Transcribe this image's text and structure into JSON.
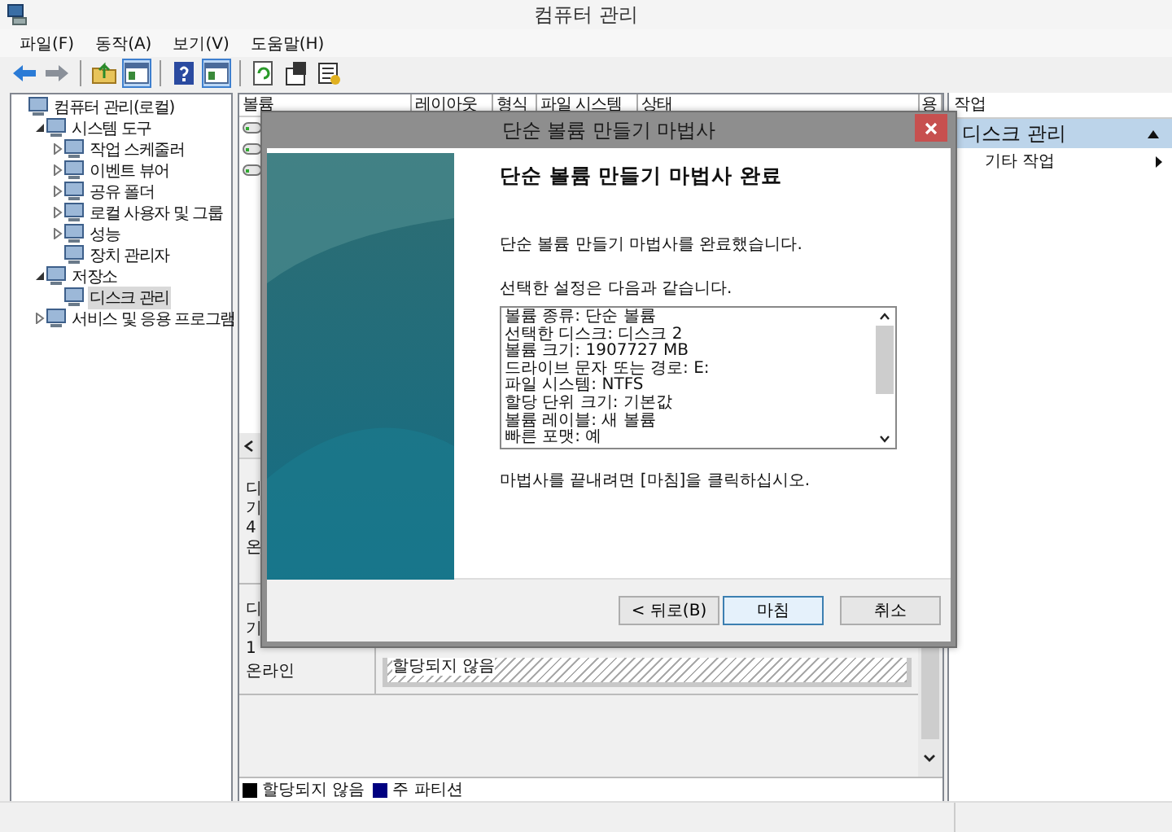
{
  "window": {
    "title": "컴퓨터 관리"
  },
  "menu": [
    "파일(F)",
    "동작(A)",
    "보기(V)",
    "도움말(H)"
  ],
  "toolbar": [
    {
      "kind": "back",
      "pressed": false
    },
    {
      "kind": "forward",
      "pressed": false
    },
    {
      "kind": "sep"
    },
    {
      "kind": "folder",
      "pressed": false
    },
    {
      "kind": "pane",
      "pressed": true
    },
    {
      "kind": "sep"
    },
    {
      "kind": "help",
      "pressed": false
    },
    {
      "kind": "pane",
      "pressed": true
    },
    {
      "kind": "sep"
    },
    {
      "kind": "refresh",
      "pressed": false
    },
    {
      "kind": "properties",
      "pressed": false
    },
    {
      "kind": "export",
      "pressed": false
    }
  ],
  "tree": [
    {
      "label": "컴퓨터 관리(로컬)",
      "selected": false,
      "children": [
        {
          "label": "시스템 도구",
          "expanded": true,
          "selected": false,
          "children": [
            {
              "label": "작업 스케줄러",
              "expanded": false,
              "selected": false
            },
            {
              "label": "이벤트 뷰어",
              "expanded": false,
              "selected": false
            },
            {
              "label": "공유 폴더",
              "expanded": false,
              "selected": false
            },
            {
              "label": "로컬 사용자 및 그룹",
              "expanded": false,
              "selected": false
            },
            {
              "label": "성능",
              "expanded": false,
              "selected": false
            },
            {
              "label": "장치 관리자",
              "selected": false
            }
          ]
        },
        {
          "label": "저장소",
          "expanded": true,
          "selected": false,
          "children": [
            {
              "label": "디스크 관리",
              "selected": true
            }
          ]
        },
        {
          "label": "서비스 및 응용 프로그램",
          "expanded": false,
          "selected": false
        }
      ]
    }
  ],
  "columns": [
    "볼륨",
    "레이아웃",
    "형식",
    "파일 시스템",
    "상태",
    "용"
  ],
  "disks": [
    {
      "lines": [
        "디",
        "기",
        "4",
        "온"
      ]
    },
    {
      "lines": [
        "디",
        "기",
        "1"
      ],
      "status": "온라인",
      "partition": "할당되지 않음"
    }
  ],
  "legend": [
    {
      "label": "할당되지 않음",
      "color": "#000000"
    },
    {
      "label": "주 파티션",
      "color": "#000080"
    }
  ],
  "actions": {
    "header": "작업",
    "section": "디스크 관리",
    "items": [
      "기타 작업"
    ]
  },
  "wizard": {
    "title": "단순 볼륨 만들기 마법사",
    "heading": "단순 볼륨 만들기 마법사 완료",
    "intro": "단순 볼륨 만들기 마법사를 완료했습니다.",
    "settings_label": "선택한 설정은 다음과 같습니다.",
    "settings": [
      "볼륨 종류: 단순 볼륨",
      "선택한 디스크: 디스크 2",
      "볼륨 크기: 1907727 MB",
      "드라이브 문자 또는 경로: E:",
      "파일 시스템: NTFS",
      "할당 단위 크기: 기본값",
      "볼륨 레이블: 새 볼륨",
      "빠른 포맷: 예"
    ],
    "outro": "마법사를 끝내려면 [마침]을 클릭하십시오.",
    "buttons": [
      {
        "label": "< 뒤로(B)",
        "default": false
      },
      {
        "label": "마침",
        "default": true
      },
      {
        "label": "취소",
        "default": false
      }
    ]
  }
}
